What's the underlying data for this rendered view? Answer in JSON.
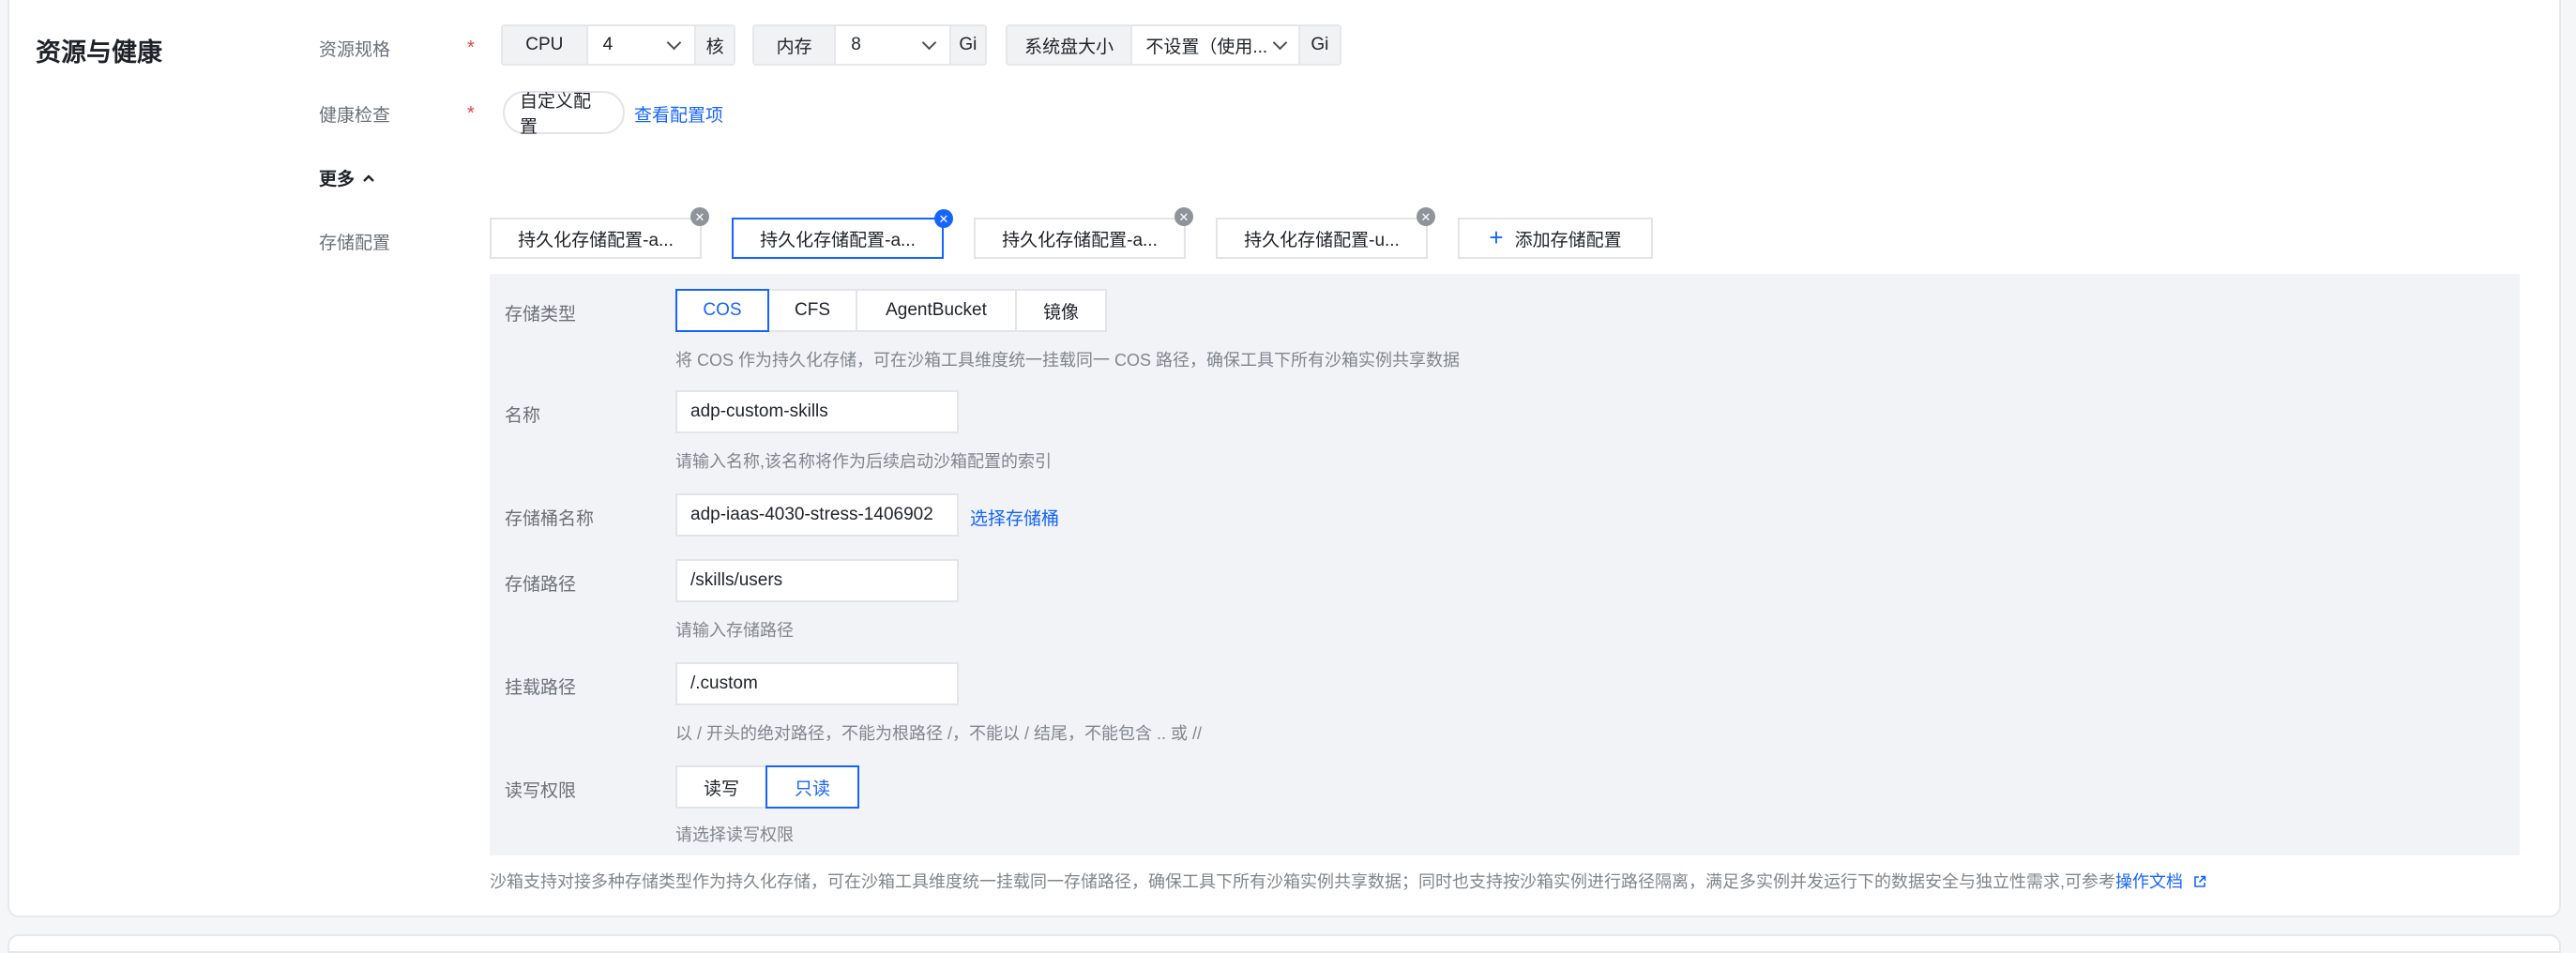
{
  "section_title": "资源与健康",
  "resource": {
    "label": "资源规格",
    "required": "*",
    "cpu": {
      "label": "CPU",
      "value": "4",
      "unit": "核"
    },
    "memory": {
      "label": "内存",
      "value": "8",
      "unit": "Gi"
    },
    "disk": {
      "label": "系统盘大小",
      "value": "不设置（使用...",
      "unit": "Gi"
    }
  },
  "health": {
    "label": "健康检查",
    "required": "*",
    "button": "自定义配置",
    "link": "查看配置项"
  },
  "more": {
    "label": "更多"
  },
  "storage": {
    "label": "存储配置",
    "tabs": [
      {
        "label": "持久化存储配置-a...",
        "active": false
      },
      {
        "label": "持久化存储配置-a...",
        "active": true
      },
      {
        "label": "持久化存储配置-a...",
        "active": false
      },
      {
        "label": "持久化存储配置-u...",
        "active": false
      }
    ],
    "add_label": "添加存储配置",
    "form": {
      "type_label": "存储类型",
      "types": [
        "COS",
        "CFS",
        "AgentBucket",
        "镜像"
      ],
      "type_selected": "COS",
      "type_help": "将 COS 作为持久化存储，可在沙箱工具维度统一挂载同一 COS 路径，确保工具下所有沙箱实例共享数据",
      "name_label": "名称",
      "name_value": "adp-custom-skills",
      "name_help": "请输入名称,该名称将作为后续启动沙箱配置的索引",
      "bucket_label": "存储桶名称",
      "bucket_value": "adp-iaas-4030-stress-1406902",
      "bucket_link": "选择存储桶",
      "path_label": "存储路径",
      "path_value": "/skills/users",
      "path_help": "请输入存储路径",
      "mount_label": "挂载路径",
      "mount_value": "/.custom",
      "mount_help": "以 / 开头的绝对路径，不能为根路径 /，不能以 / 结尾，不能包含 .. 或 //",
      "perm_label": "读写权限",
      "perms": [
        "读写",
        "只读"
      ],
      "perm_selected": "只读",
      "perm_help": "请选择读写权限"
    },
    "footer_note": "沙箱支持对接多种存储类型作为持久化存储，可在沙箱工具维度统一挂载同一存储路径，确保工具下所有沙箱实例共享数据；同时也支持按沙箱实例进行路径隔离，满足多实例并发运行下的数据安全与独立性需求,可参考",
    "footer_link": "操作文档"
  },
  "colors": {
    "accent": "#1664ff",
    "required": "#e54545",
    "panel_bg": "#f1f3f6"
  }
}
